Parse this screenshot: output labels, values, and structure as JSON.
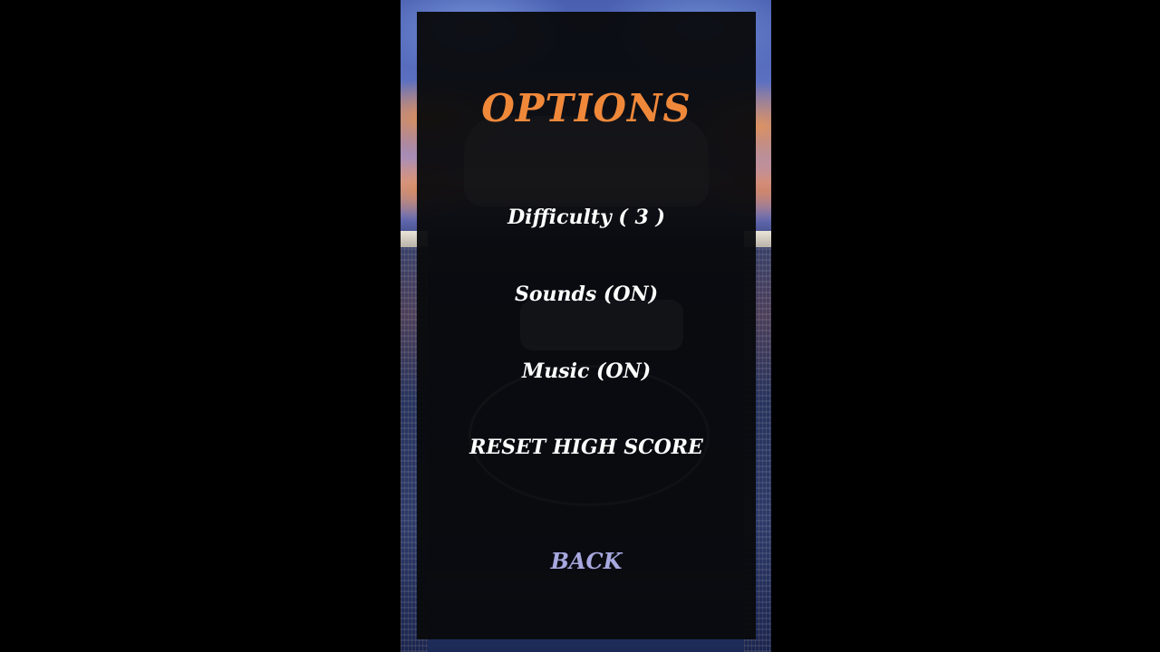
{
  "options_menu": {
    "title": "OPTIONS",
    "difficulty_label": "Difficulty ( 3 )",
    "sounds_label": "Sounds (ON)",
    "music_label": "Music (ON)",
    "reset_label": "RESET HIGH SCORE",
    "back_label": "BACK"
  },
  "colors": {
    "title": "#f0883a",
    "item_text": "#ffffff",
    "back_text": "#a8a8e0",
    "panel": "#08090c"
  }
}
